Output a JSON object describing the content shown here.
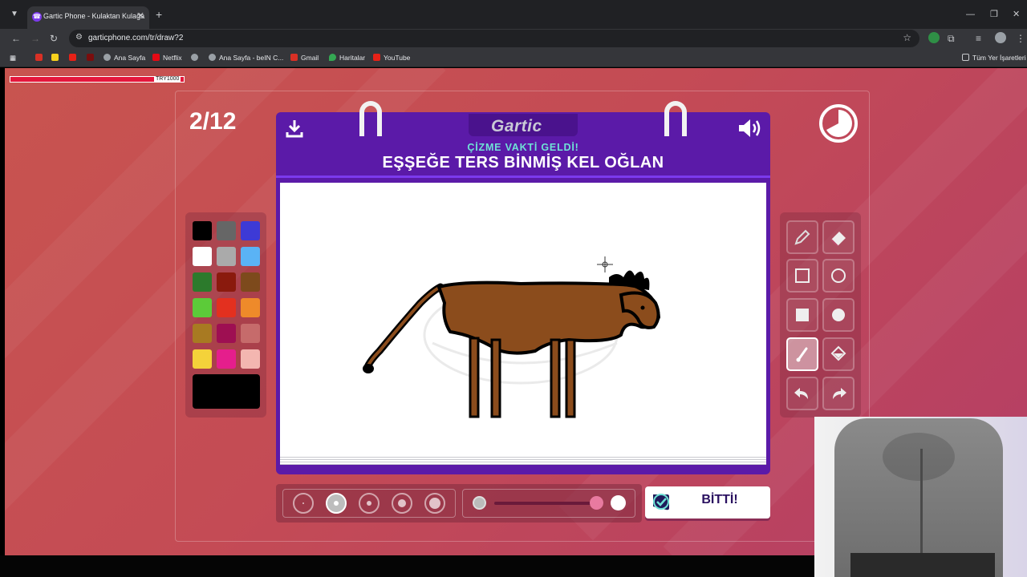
{
  "browser": {
    "tab_title": "Gartic Phone - Kulaktan Kulağa",
    "url": "garticphone.com/tr/draw?2",
    "bookmarks": [
      "Ana Sayfa",
      "Netflix",
      "Ana Sayfa - beIN C...",
      "Gmail",
      "Haritalar",
      "YouTube"
    ],
    "bookmarks_right": "Tüm Yer İşaretleri"
  },
  "overlay": {
    "power_value": "TRY1000"
  },
  "game": {
    "round": "2/12",
    "brand": "Gartic",
    "subtitle": "ÇİZME VAKTİ GELDİ!",
    "phrase": "EŞŞEĞE TERS BİNMİŞ KEL OĞLAN",
    "done_label": "BİTTİ!",
    "selected_size_index": 1,
    "opacity_level": 0.85,
    "active_tool": "line-tool",
    "current_color": "#000000"
  },
  "palette": {
    "colors": [
      [
        "#000000",
        "#666666",
        "#3d3ad6"
      ],
      [
        "#ffffff",
        "#aaaaaa",
        "#5ab3f5"
      ],
      [
        "#2c7a2c",
        "#8a1a0d",
        "#7d4a1c"
      ],
      [
        "#5ccb39",
        "#e3301f",
        "#ee8a2a"
      ],
      [
        "#a87a22",
        "#9e0f52",
        "#c66b6b"
      ],
      [
        "#f4d23a",
        "#e51e8c",
        "#f3b6b0"
      ]
    ]
  }
}
